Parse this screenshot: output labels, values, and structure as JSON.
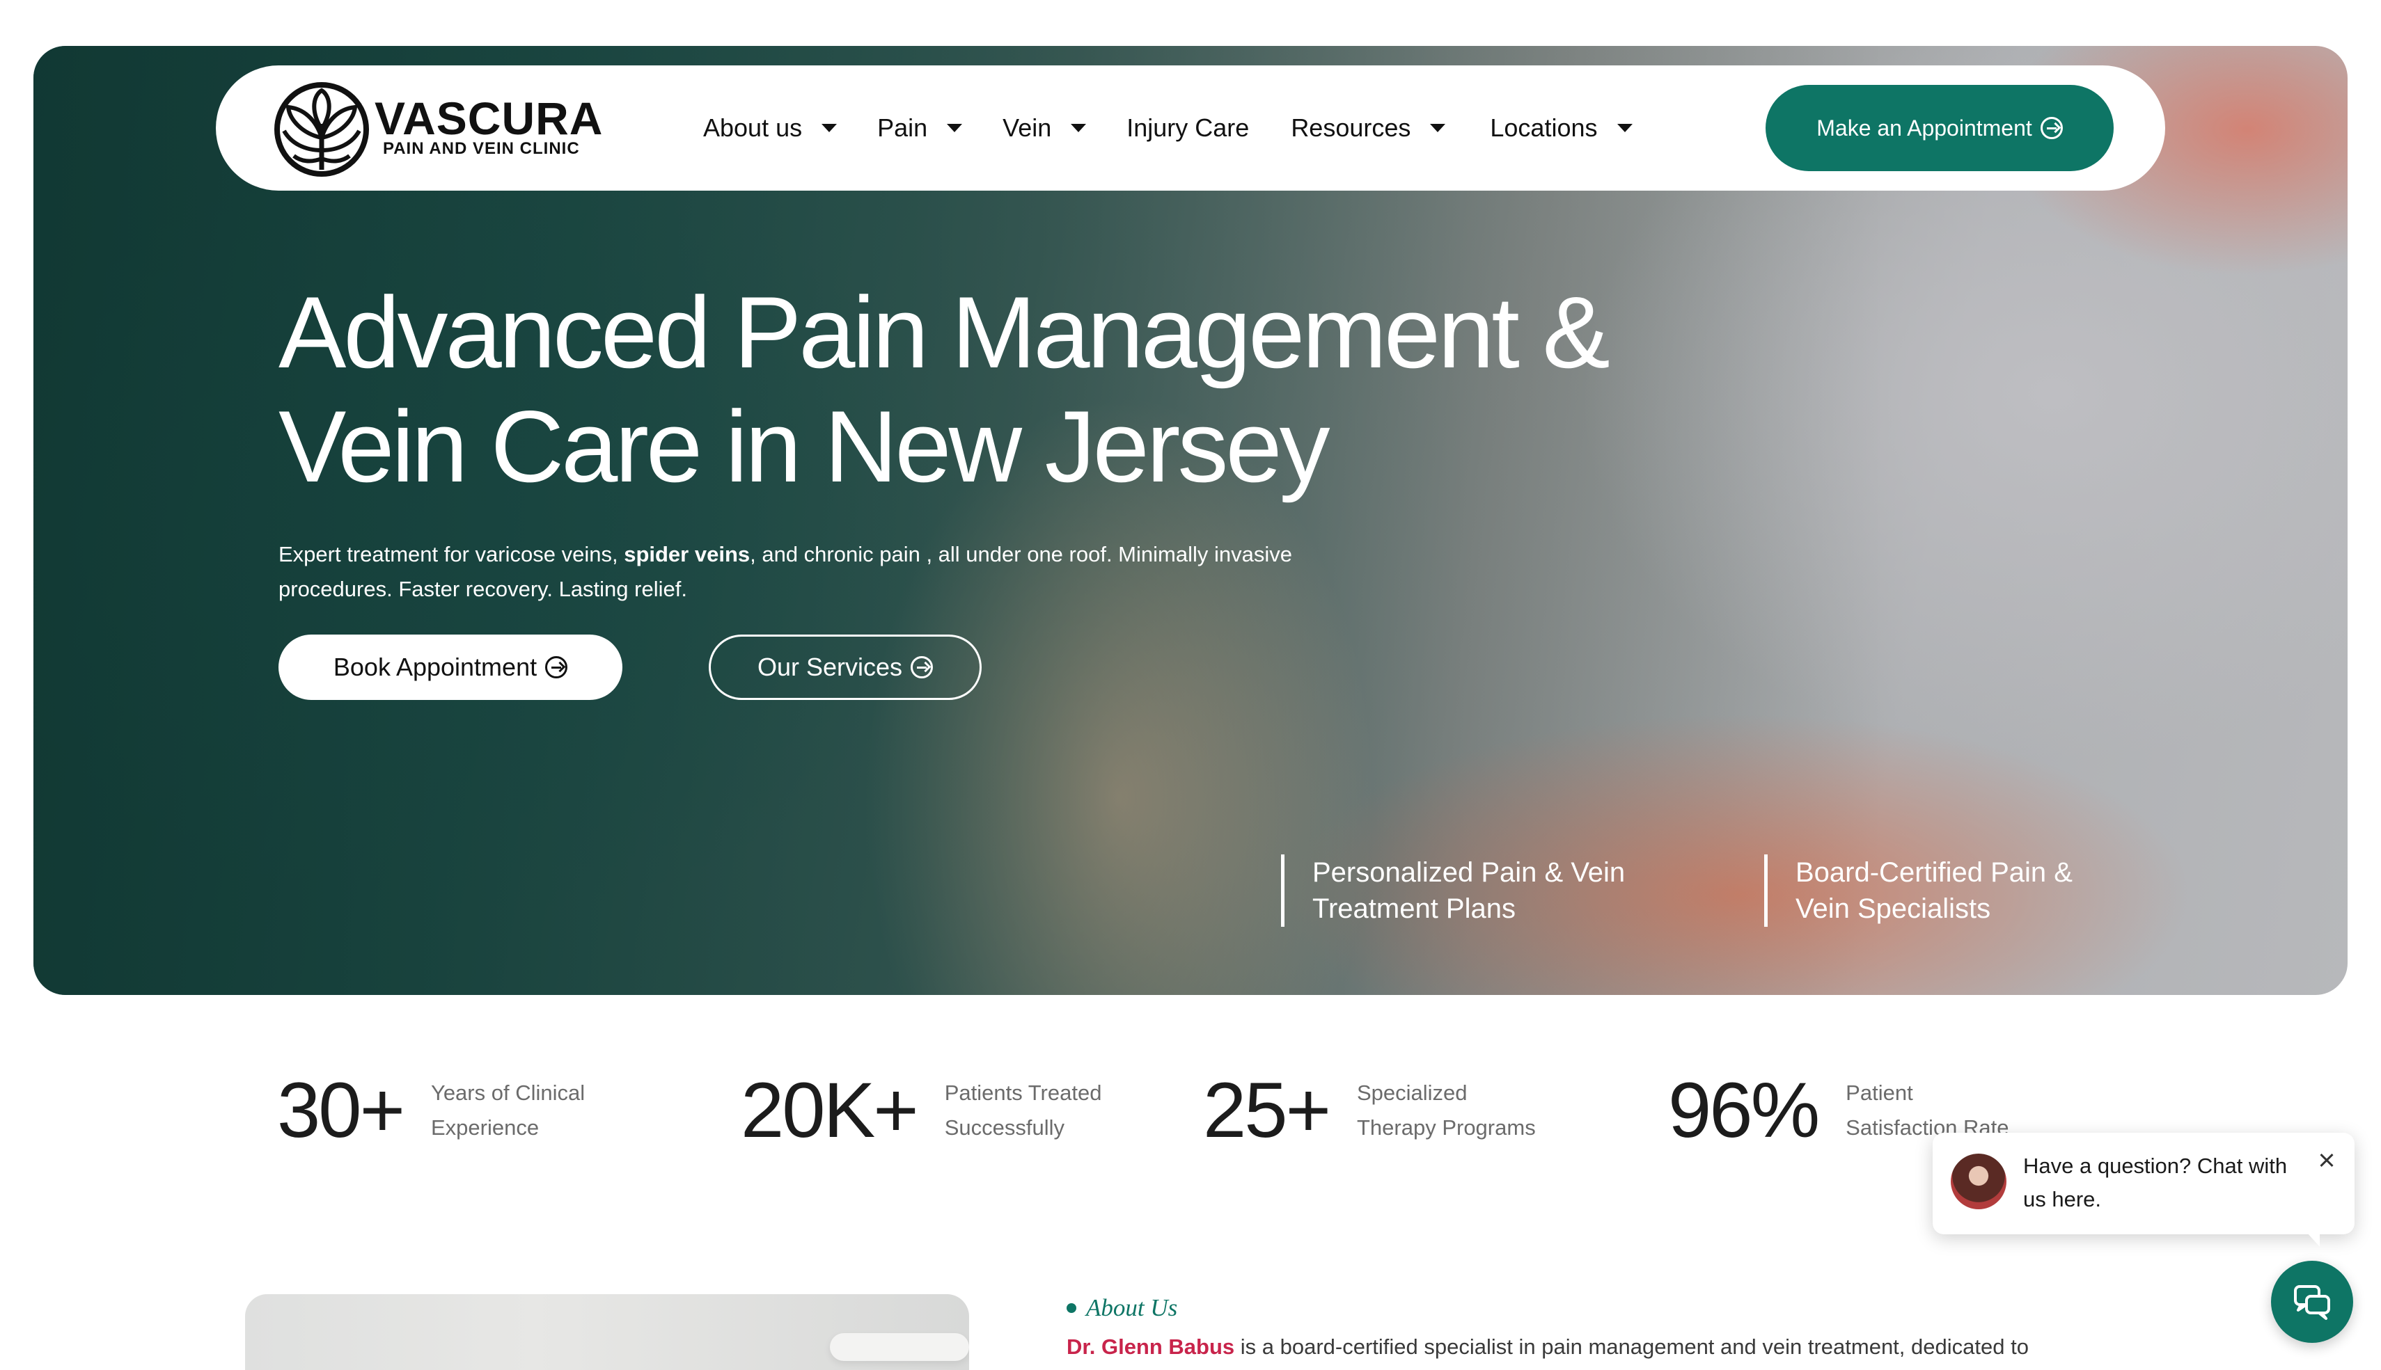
{
  "brand": {
    "name": "VASCURA",
    "tagline": "PAIN AND VEIN CLINIC"
  },
  "nav": {
    "items": [
      {
        "label": "About us",
        "dropdown": true
      },
      {
        "label": "Pain",
        "dropdown": true
      },
      {
        "label": "Vein",
        "dropdown": true
      },
      {
        "label": "Injury Care",
        "dropdown": false
      },
      {
        "label": "Resources",
        "dropdown": true
      },
      {
        "label": "Locations",
        "dropdown": true
      }
    ],
    "cta_label": "Make an Appointment"
  },
  "hero": {
    "title_line1": "Advanced Pain Management &",
    "title_line2": "Vein Care in New Jersey",
    "desc_part1": "Expert treatment for varicose veins, ",
    "desc_bold": "spider veins",
    "desc_part2": ", and chronic pain , all under one roof. Minimally invasive procedures. Faster recovery. Lasting relief.",
    "btn_book": "Book Appointment",
    "btn_services": "Our Services",
    "features": [
      {
        "line1": "Personalized Pain & Vein",
        "line2": "Treatment Plans"
      },
      {
        "line1": "Board-Certified Pain &",
        "line2": "Vein Specialists"
      }
    ]
  },
  "stats": [
    {
      "value": "30+",
      "label_line1": "Years of Clinical",
      "label_line2": "Experience"
    },
    {
      "value": "20K+",
      "label_line1": "Patients Treated",
      "label_line2": "Successfully"
    },
    {
      "value": "25+",
      "label_line1": "Specialized",
      "label_line2": "Therapy Programs"
    },
    {
      "value": "96%",
      "label_line1": "Patient",
      "label_line2": "Satisfaction Rate"
    }
  ],
  "about": {
    "tag": "About Us",
    "doctor": "Dr. Glenn Babus",
    "text": " is a board-certified specialist in pain management and vein treatment, dedicated to"
  },
  "chat": {
    "message": "Have a question? Chat with us here."
  },
  "colors": {
    "accent": "#0e7565",
    "doctor_highlight": "#c8244b"
  },
  "icons": {
    "logo": "tree-of-life-icon",
    "cta_arrow": "circle-arrow-right-icon",
    "chat": "chat-bubbles-icon"
  }
}
